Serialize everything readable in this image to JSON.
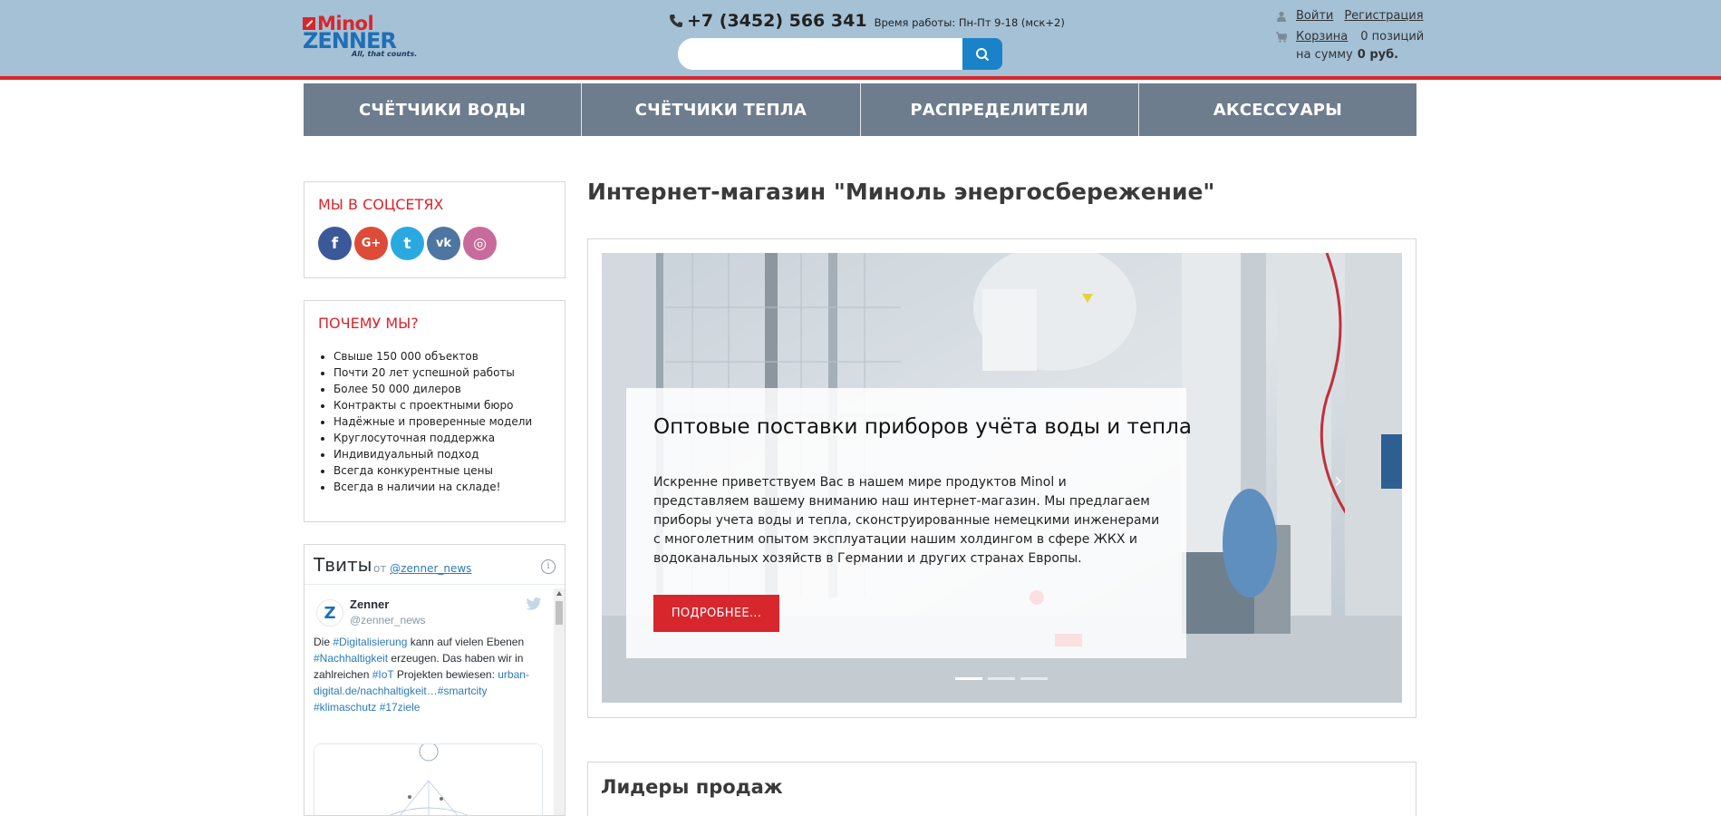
{
  "brand": {
    "line1": "Minol",
    "line2": "ZENNER",
    "tagline": "All, that counts."
  },
  "header": {
    "phone": "+7 (3452) 566 341",
    "hours": "Время работы: Пн-Пт 9-18 (мск+2)",
    "search_placeholder": "",
    "login": "Войти",
    "register": "Регистрация",
    "cart": "Корзина",
    "cart_count": "0 позиций",
    "cart_sum_label": "на сумму",
    "cart_sum": "0 руб."
  },
  "nav": {
    "items": [
      "СЧЁТЧИКИ ВОДЫ",
      "СЧЁТЧИКИ ТЕПЛА",
      "РАСПРЕДЕЛИТЕЛИ",
      "АКСЕССУАРЫ"
    ]
  },
  "social": {
    "title": "МЫ В СОЦСЕТЯХ",
    "icons": [
      {
        "name": "facebook-icon",
        "glyph": "f",
        "color": "#3b5998"
      },
      {
        "name": "google-plus-icon",
        "glyph": "G+",
        "color": "#dd4b39"
      },
      {
        "name": "twitter-icon",
        "glyph": "t",
        "color": "#2aa9e0"
      },
      {
        "name": "vk-icon",
        "glyph": "vk",
        "color": "#4d76a1"
      },
      {
        "name": "instagram-icon",
        "glyph": "◎",
        "color": "#c96b9a"
      }
    ]
  },
  "why": {
    "title": "ПОЧЕМУ МЫ?",
    "items": [
      "Свыше 150 000 объектов",
      "Почти 20 лет успешной работы",
      "Более 50 000 дилеров",
      "Контракты с проектными бюро",
      "Надёжные и проверенные модели",
      "Круглосуточная поддержка",
      "Индивидуальный подход",
      "Всегда конкурентные цены",
      "Всегда в наличии на складе!"
    ]
  },
  "tweets": {
    "title": "Твиты",
    "by": "от",
    "account": "@zenner_news",
    "tweet": {
      "name": "Zenner",
      "handle": "@zenner_news",
      "text_parts": [
        {
          "t": "Die ",
          "tag": false
        },
        {
          "t": "#Digitalisierung",
          "tag": true
        },
        {
          "t": " kann auf vielen Ebenen ",
          "tag": false
        },
        {
          "t": "#Nachhaltigkeit",
          "tag": true
        },
        {
          "t": " erzeugen. Das haben wir in zahlreichen ",
          "tag": false
        },
        {
          "t": "#IoT",
          "tag": true
        },
        {
          "t": " Projekten bewiesen:  ",
          "tag": false
        },
        {
          "t": "urban-digital.de/nachhaltigkeit…",
          "tag": true
        },
        {
          "t": "#smartcity",
          "tag": true
        },
        {
          "t": " ",
          "tag": false
        },
        {
          "t": "#klimaschutz",
          "tag": true
        },
        {
          "t": " ",
          "tag": false
        },
        {
          "t": "#17ziele",
          "tag": true
        }
      ]
    }
  },
  "main": {
    "title": "Интернет-магазин \"Миноль энергосбережение\"",
    "slide": {
      "heading": "Оптовые поставки приборов учёта воды и тепла",
      "text": "Искренне приветствуем Вас в нашем мире продуктов Minol и представляем вашему вниманию наш интернет-магазин. Мы предлагаем приборы учета воды и тепла, сконструированные немецкими инженерами с многолетним опытом эксплуатации нашим холдингом в сфере ЖКХ и водоканальных хозяйств в Германии и других странах Европы.",
      "button": "ПОДРОБНЕЕ...",
      "next": "›",
      "dots": 3,
      "active_dot": 0
    },
    "leaders_title": "Лидеры продаж"
  }
}
